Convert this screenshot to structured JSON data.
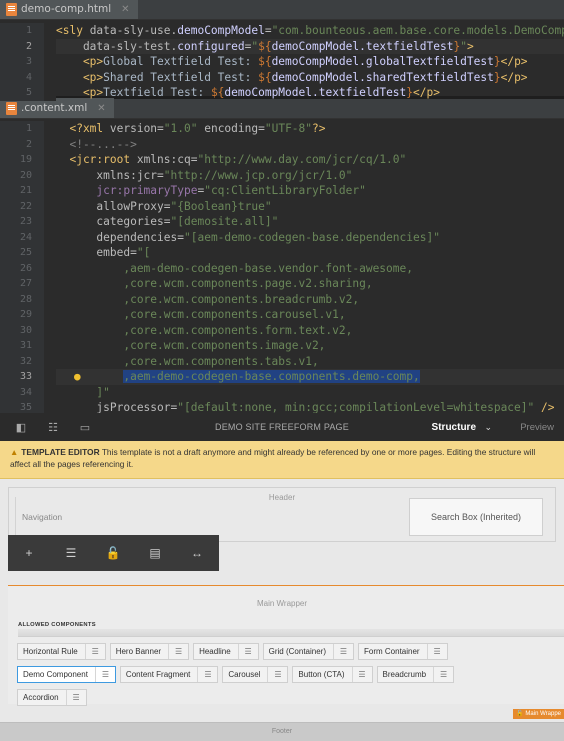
{
  "editor_top": {
    "tab_label": "demo-comp.html",
    "lines": [
      {
        "num": "1",
        "current": false,
        "segments": [
          [
            "t-tag",
            "<sly "
          ],
          [
            "t-attr",
            "data-sly-use."
          ],
          [
            "t-var",
            "demoCompModel"
          ],
          [
            "t-attr",
            "="
          ],
          [
            "t-str",
            "\"com.bounteous.aem.base.core.models.DemoComp\""
          ]
        ]
      },
      {
        "num": "2",
        "current": true,
        "segments": [
          [
            "t-attr",
            "    data-sly-test."
          ],
          [
            "t-var",
            "configured"
          ],
          [
            "t-attr",
            "="
          ],
          [
            "t-str",
            "\""
          ],
          [
            "t-expr",
            "${"
          ],
          [
            "t-var",
            "demoCompModel.textfieldTest"
          ],
          [
            "t-expr",
            "}"
          ],
          [
            "t-str",
            "\""
          ],
          [
            "t-tag",
            ">"
          ]
        ]
      },
      {
        "num": "3",
        "current": false,
        "segments": [
          [
            "t-tag",
            "    <p>"
          ],
          [
            "t-text",
            "Global Textfield Test: "
          ],
          [
            "t-expr",
            "${"
          ],
          [
            "t-var",
            "demoCompModel.globalTextfieldTest"
          ],
          [
            "t-expr",
            "}"
          ],
          [
            "t-tag",
            "</p>"
          ]
        ]
      },
      {
        "num": "4",
        "current": false,
        "segments": [
          [
            "t-tag",
            "    <p>"
          ],
          [
            "t-text",
            "Shared Textfield Test: "
          ],
          [
            "t-expr",
            "${"
          ],
          [
            "t-var",
            "demoCompModel.sharedTextfieldTest"
          ],
          [
            "t-expr",
            "}"
          ],
          [
            "t-tag",
            "</p>"
          ]
        ]
      },
      {
        "num": "5",
        "current": false,
        "segments": [
          [
            "t-tag",
            "    <p>"
          ],
          [
            "t-text",
            "Textfield Test: "
          ],
          [
            "t-expr",
            "${"
          ],
          [
            "t-var",
            "demoCompModel.textfieldTest"
          ],
          [
            "t-expr",
            "}"
          ],
          [
            "t-tag",
            "</p>"
          ]
        ]
      }
    ]
  },
  "editor_bottom": {
    "tab_label": ".content.xml",
    "lines": [
      {
        "num": "1",
        "segments": [
          [
            "t-tag",
            "  <?xml "
          ],
          [
            "t-attr",
            "version"
          ],
          [
            "t-attr",
            "="
          ],
          [
            "t-str",
            "\"1.0\" "
          ],
          [
            "t-attr",
            "encoding"
          ],
          [
            "t-attr",
            "="
          ],
          [
            "t-str",
            "\"UTF-8\""
          ],
          [
            "t-tag",
            "?>"
          ]
        ]
      },
      {
        "num": "2",
        "segments": [
          [
            "t-comment",
            "  <!--...-->"
          ]
        ]
      },
      {
        "num": "19",
        "segments": [
          [
            "t-tag",
            "  <jcr:root "
          ],
          [
            "t-attr",
            "xmlns:cq"
          ],
          [
            "t-attr",
            "="
          ],
          [
            "t-str",
            "\"http://www.day.com/jcr/cq/1.0\""
          ]
        ]
      },
      {
        "num": "20",
        "segments": [
          [
            "t-attr",
            "      xmlns:jcr"
          ],
          [
            "t-attr",
            "="
          ],
          [
            "t-str",
            "\"http://www.jcp.org/jcr/1.0\""
          ]
        ]
      },
      {
        "num": "21",
        "segments": [
          [
            "t-ns",
            "      jcr:primaryType"
          ],
          [
            "t-attr",
            "="
          ],
          [
            "t-str",
            "\"cq:ClientLibraryFolder\""
          ]
        ]
      },
      {
        "num": "22",
        "segments": [
          [
            "t-attr",
            "      allowProxy"
          ],
          [
            "t-attr",
            "="
          ],
          [
            "t-str",
            "\"{Boolean}true\""
          ]
        ]
      },
      {
        "num": "23",
        "segments": [
          [
            "t-attr",
            "      categories"
          ],
          [
            "t-attr",
            "="
          ],
          [
            "t-str",
            "\"[demosite.all]\""
          ]
        ]
      },
      {
        "num": "24",
        "segments": [
          [
            "t-attr",
            "      dependencies"
          ],
          [
            "t-attr",
            "="
          ],
          [
            "t-str",
            "\"[aem-demo-codegen-base.dependencies]\""
          ]
        ]
      },
      {
        "num": "25",
        "segments": [
          [
            "t-attr",
            "      embed"
          ],
          [
            "t-attr",
            "="
          ],
          [
            "t-str",
            "\"["
          ]
        ]
      },
      {
        "num": "26",
        "segments": [
          [
            "t-str",
            "          ,aem-demo-codegen-base.vendor.font-awesome,"
          ]
        ]
      },
      {
        "num": "27",
        "segments": [
          [
            "t-str",
            "          ,core.wcm.components.page.v2.sharing,"
          ]
        ]
      },
      {
        "num": "28",
        "segments": [
          [
            "t-str",
            "          ,core.wcm.components.breadcrumb.v2,"
          ]
        ]
      },
      {
        "num": "29",
        "segments": [
          [
            "t-str",
            "          ,core.wcm.components.carousel.v1,"
          ]
        ]
      },
      {
        "num": "30",
        "segments": [
          [
            "t-str",
            "          ,core.wcm.components.form.text.v2,"
          ]
        ]
      },
      {
        "num": "31",
        "segments": [
          [
            "t-str",
            "          ,core.wcm.components.image.v2,"
          ]
        ]
      },
      {
        "num": "32",
        "segments": [
          [
            "t-str",
            "          ,core.wcm.components.tabs.v1,"
          ]
        ]
      },
      {
        "num": "33",
        "segments": [
          [
            "t-str",
            "          "
          ],
          [
            "t-str hl",
            ",aem-demo-codegen-base.components.demo-comp,"
          ]
        ]
      },
      {
        "num": "34",
        "segments": [
          [
            "t-str",
            "      ]\""
          ]
        ]
      },
      {
        "num": "35",
        "segments": [
          [
            "t-attr",
            "      jsProcessor"
          ],
          [
            "t-attr",
            "="
          ],
          [
            "t-str",
            "\"[default:none, min:gcc;compilationLevel=whitespace]\""
          ],
          [
            "t-tag",
            " />"
          ]
        ]
      }
    ]
  },
  "aem": {
    "page_title": "DEMO SITE FREEFORM PAGE",
    "mode": "Structure",
    "preview": "Preview",
    "warning_title": "TEMPLATE EDITOR",
    "warning_text": "This template is not a draft anymore and might already be referenced by one or more pages. Editing the structure will affect all the pages referencing it.",
    "header_label": "Header",
    "navigation_label": "Navigation",
    "search_box_label": "Search Box (Inherited)",
    "main_wrapper_label": "Main Wrapper",
    "allowed_components_label": "ALLOWED COMPONENTS",
    "components_row1": [
      "Horizontal Rule",
      "Hero Banner",
      "Headline",
      "Grid (Container)",
      "Form Container"
    ],
    "components_row2": [
      "Demo Component",
      "Content Fragment",
      "Carousel",
      "Button (CTA)",
      "Breadcrumb"
    ],
    "components_row3": [
      "Accordion"
    ],
    "selected_component": "Demo Component",
    "badge_label": "Main Wrappe",
    "footer_label": "Footer",
    "accent_color": "#e68a2e",
    "warning_color": "#f5d88a"
  }
}
